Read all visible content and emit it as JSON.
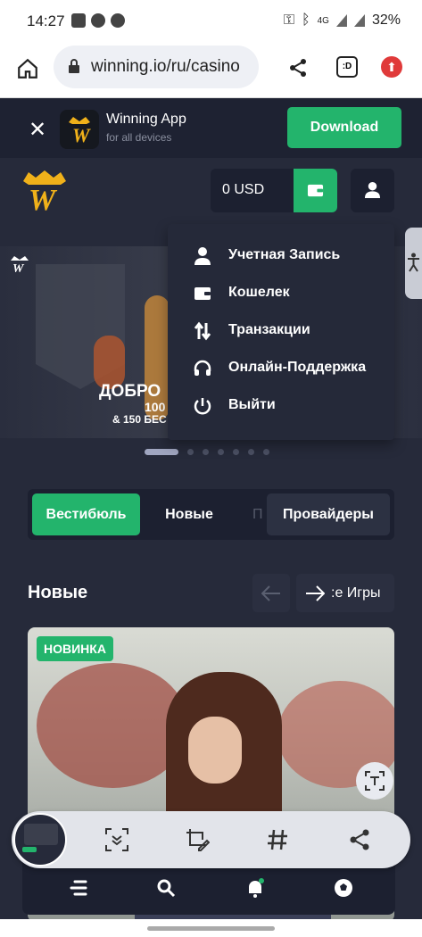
{
  "status_bar": {
    "time": "14:27",
    "battery": "32%",
    "network": "4G"
  },
  "browser": {
    "url": "winning.io/ru/casino"
  },
  "app_banner": {
    "name": "Winning App",
    "subtitle": "for all devices",
    "download_label": "Download"
  },
  "header": {
    "balance": "0 USD"
  },
  "banner": {
    "line1": "ДОБРО",
    "line2": "100",
    "line3": "& 150 БЕС"
  },
  "account_menu": {
    "items": [
      {
        "label": "Учетная Запись",
        "icon": "user-icon"
      },
      {
        "label": "Кошелек",
        "icon": "wallet-icon"
      },
      {
        "label": "Транзакции",
        "icon": "transactions-icon"
      },
      {
        "label": "Онлайн-Поддержка",
        "icon": "headset-icon"
      },
      {
        "label": "Выйти",
        "icon": "power-icon"
      }
    ]
  },
  "tabs": [
    "Вестибюль",
    "Новые",
    "П",
    "Провайдеры"
  ],
  "section": {
    "title": "Новые",
    "more": ":е Игры"
  },
  "game_card": {
    "badge": "НОВИНКА"
  },
  "colors": {
    "accent": "#23b46c",
    "background": "#262a3a",
    "panel": "#1c2030"
  }
}
